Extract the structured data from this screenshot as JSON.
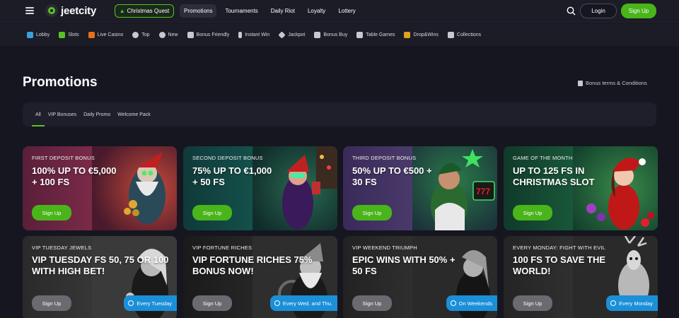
{
  "header": {
    "logo_text": "jeetcity",
    "quest_label": "Christmas Quest",
    "nav": [
      "Promotions",
      "Tournaments",
      "Daily Riot",
      "Loyalty",
      "Lottery"
    ],
    "login": "Login",
    "signup": "Sign Up"
  },
  "categories": [
    {
      "label": "Lobby",
      "color": "#3aa0e0"
    },
    {
      "label": "Slots",
      "color": "#58c324"
    },
    {
      "label": "Live Casino",
      "color": "#e8701a"
    },
    {
      "label": "Top",
      "color": "#c8c8d0"
    },
    {
      "label": "New",
      "color": "#c8c8d0"
    },
    {
      "label": "Bonus Friendly",
      "color": "#c8c8d0"
    },
    {
      "label": "Instant Win",
      "color": "#c8c8d0"
    },
    {
      "label": "Jackpot",
      "color": "#c8c8d0"
    },
    {
      "label": "Bonus Buy",
      "color": "#c8c8d0"
    },
    {
      "label": "Table Games",
      "color": "#c8c8d0"
    },
    {
      "label": "Drop&Wins",
      "color": "#e0a020"
    },
    {
      "label": "Collections",
      "color": "#c8c8d0"
    }
  ],
  "page": {
    "title": "Promotions",
    "terms": "Bonus terms & Conditions"
  },
  "tabs": [
    "All",
    "VIP Bonuses",
    "Daily Promo",
    "Welcome Pack"
  ],
  "promos": [
    {
      "kicker": "FIRST DEPOSIT BONUS",
      "headline": "100% UP TO €5,000 + 100 FS",
      "cta": "Sign Up",
      "tag": ""
    },
    {
      "kicker": "SECOND DEPOSIT BONUS",
      "headline": "75% UP TO €1,000 + 50 FS",
      "cta": "Sign Up",
      "tag": ""
    },
    {
      "kicker": "THIRD DEPOSIT BONUS",
      "headline": "50% UP TO €500 + 30 FS",
      "cta": "Sign Up",
      "tag": ""
    },
    {
      "kicker": "GAME OF THE MONTH",
      "headline": "UP TO 125 FS IN CHRISTMAS SLOT",
      "cta": "Sign Up",
      "tag": ""
    },
    {
      "kicker": "VIP TUESDAY JEWELS",
      "headline": "VIP TUESDAY FS 50, 75 OR 100 WITH HIGH BET!",
      "cta": "Sign Up",
      "tag": "Every Tuesday"
    },
    {
      "kicker": "VIP FORTUNE RICHES",
      "headline": "VIP FORTUNE RICHES 75% BONUS NOW!",
      "cta": "Sign Up",
      "tag": "Every Wed. and Thu."
    },
    {
      "kicker": "VIP WEEKEND TRIUMPH",
      "headline": "EPIC WINS WITH 50% + 50 FS",
      "cta": "Sign Up",
      "tag": "On Weekends"
    },
    {
      "kicker": "EVERY MONDAY: FIGHT WITH EVIL",
      "headline": "100 FS TO SAVE THE WORLD!",
      "cta": "Sign Up",
      "tag": "Every Monday"
    }
  ]
}
